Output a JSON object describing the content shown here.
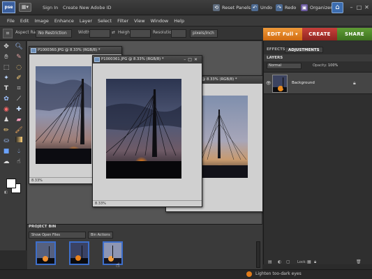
{
  "app": {
    "logo_text": "pse"
  },
  "titlebar": {
    "sign_in": "Sign In",
    "create_id": "Create New Adobe ID",
    "reset_panels": "Reset Panels",
    "undo": "Undo",
    "redo": "Redo",
    "organizer": "Organizer"
  },
  "menu": [
    "File",
    "Edit",
    "Image",
    "Enhance",
    "Layer",
    "Select",
    "Filter",
    "View",
    "Window",
    "Help"
  ],
  "options": {
    "aspect_ratio_label": "Aspect Ratio:",
    "aspect_ratio_value": "No Restriction",
    "width_label": "Width:",
    "height_label": "Height:",
    "resolution_label": "Resolution:",
    "resolution_unit": "pixels/inch"
  },
  "modes": {
    "edit": "EDIT Full",
    "create": "CREATE",
    "share": "SHARE"
  },
  "colors": {
    "edit_orange": "#e07b1a",
    "create_red": "#b0312b",
    "share_green": "#4f8a2c",
    "accent_blue": "#3d6fcc"
  },
  "documents": [
    {
      "title": "P1000360.JPG @ 8.33% (RGB/8) *",
      "zoom": "8.33%"
    },
    {
      "title": "P1000361.JPG @ 8.33% (RGB/8) *",
      "zoom": "8.33%"
    },
    {
      "title": "P1000362.JPG @ 8.33% (RGB/8) *",
      "zoom": "8.33%"
    }
  ],
  "panels": {
    "tab_effects": "EFFECTS",
    "tab_adjustments": "ADJUSTMENTS",
    "layers_title": "LAYERS",
    "blend_mode": "Normal",
    "opacity_label": "Opacity:",
    "opacity_value": "100%",
    "layer_name": "Background",
    "lock_label": "Lock:"
  },
  "bin": {
    "title": "PROJECT BIN",
    "dropdown": "Show Open Files",
    "actions": "Bin Actions"
  },
  "status": {
    "tip": "Lighten too-dark eyes"
  },
  "icons": [
    "search-icon",
    "move-icon",
    "zoom-icon",
    "hand-icon",
    "eyedropper-icon",
    "lasso-icon",
    "magic-wand-icon",
    "quick-selection-icon",
    "type-icon",
    "crop-icon",
    "cookie-cutter-icon",
    "straighten-icon",
    "red-eye-icon",
    "healing-icon",
    "clone-stamp-icon",
    "eraser-icon",
    "pencil-icon",
    "brush-icon",
    "paint-bucket-icon",
    "gradient-icon",
    "shape-icon",
    "blur-icon",
    "sponge-icon",
    "smudge-icon"
  ]
}
